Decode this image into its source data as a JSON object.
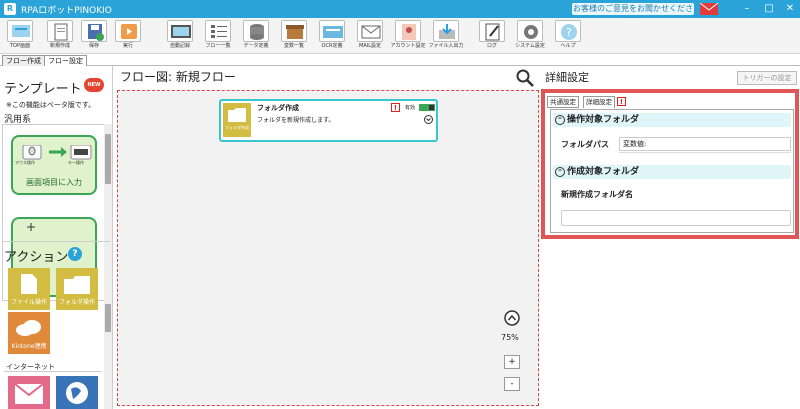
{
  "app": {
    "title": "RPAロボットPINOKIO",
    "feedback": "お客様のご意見をお聞かせください"
  },
  "ribbon": [
    {
      "label": "TOP画面",
      "icon": "top-screen-icon"
    },
    {
      "label": "新規作成",
      "icon": "new-file-icon"
    },
    {
      "label": "保存",
      "icon": "save-icon"
    },
    {
      "label": "実行",
      "icon": "run-icon"
    },
    {
      "label": "自動記録",
      "icon": "auto-record-icon"
    },
    {
      "label": "フロー一覧",
      "icon": "flow-list-icon"
    },
    {
      "label": "データ定義",
      "icon": "data-definition-icon"
    },
    {
      "label": "変数一覧",
      "icon": "variable-list-icon"
    },
    {
      "label": "OCR定義",
      "icon": "ocr-definition-icon"
    },
    {
      "label": "MAIL設定",
      "icon": "mail-settings-icon"
    },
    {
      "label": "アカウント設定",
      "icon": "account-settings-icon"
    },
    {
      "label": "ファイル入出力",
      "icon": "file-io-icon"
    },
    {
      "label": "ログ",
      "icon": "log-icon"
    },
    {
      "label": "システム設定",
      "icon": "system-settings-icon"
    },
    {
      "label": "ヘルプ",
      "icon": "help-icon"
    }
  ],
  "tabs": [
    "フロー作成",
    "フロー設定"
  ],
  "left": {
    "template_title": "テンプレート",
    "new_badge": "NEW",
    "beta_note": "※この機能はベータ版です。",
    "category": "汎用系",
    "template_card": {
      "label": "画面項目に入力",
      "mouse": "マウス操作",
      "key": "キー操作"
    },
    "action_title": "アクション",
    "actions": [
      {
        "label": "ファイル操作",
        "color": "#d2bd42"
      },
      {
        "label": "フォルダ操作",
        "color": "#d2bd42"
      },
      {
        "label": "Kintone連携",
        "color": "#e0893a"
      }
    ],
    "internet_label": "インターネット"
  },
  "canvas": {
    "title": "フロー図:  新規フロー",
    "node": {
      "title": "フォルダ作成",
      "desc": "フォルダを新規作成します。",
      "icon_label": "フォルダ作成",
      "enabled_label": "有効"
    },
    "zoom": "75%",
    "zoom_in": "+",
    "zoom_out": "-"
  },
  "right": {
    "title": "詳細設定",
    "trigger_button": "トリガーの設定",
    "tabs": [
      "共通設定",
      "詳細設定"
    ],
    "groups": [
      {
        "title": "操作対象フォルダ",
        "field_label": "フォルダパス",
        "field_value": "変数値:"
      },
      {
        "title": "作成対象フォルダ",
        "field_label": "新規作成フォルダ名",
        "field_value": ""
      }
    ]
  },
  "colors": {
    "accent": "#2aa3d8",
    "highlight": "#e05555",
    "node_border": "#39c6cc",
    "template_green": "#3aa655"
  }
}
